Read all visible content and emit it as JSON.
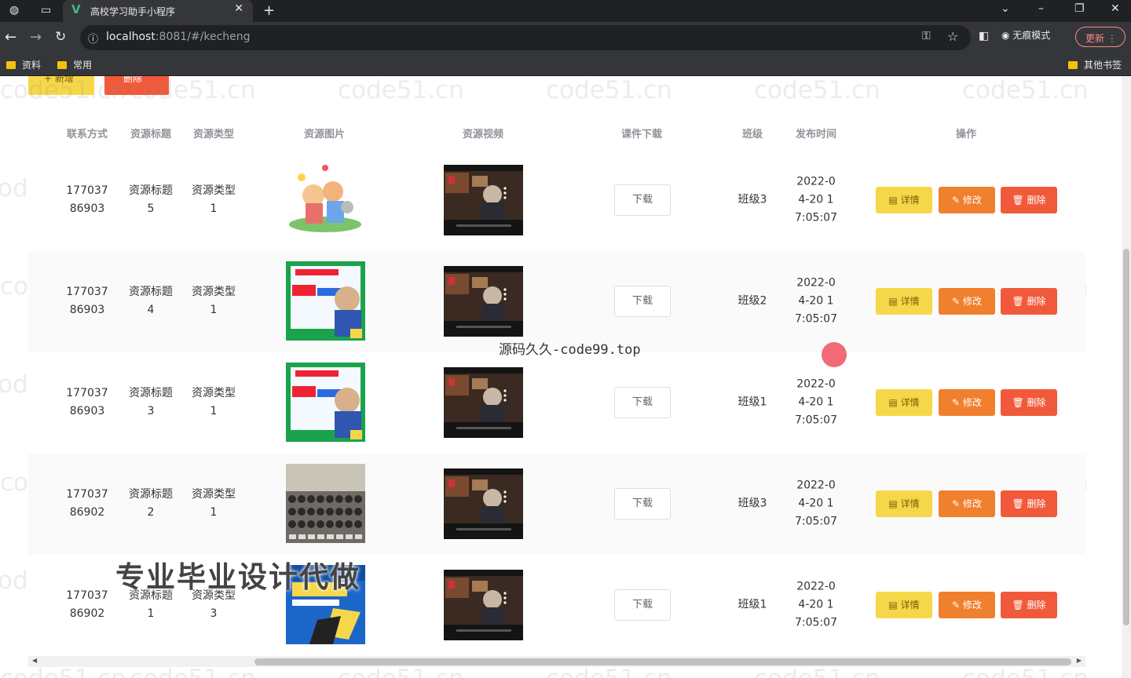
{
  "browser": {
    "tab_title": "高校学习助手小程序",
    "new_tab": "+",
    "url_host": "localhost",
    "url_rest": ":8081/#/kecheng",
    "incognito_label": "无痕模式",
    "update_label": "更新",
    "bookmarks": [
      "资料",
      "常用"
    ],
    "other_bookmarks": "其他书签"
  },
  "toolbar": {
    "add_label": "+ 新增",
    "delete_label": "删除"
  },
  "table": {
    "headers": [
      "联系方式",
      "资源标题",
      "资源类型",
      "资源图片",
      "资源视频",
      "课件下载",
      "班级",
      "发布时间",
      "操作"
    ],
    "download_label": "下载",
    "detail_label": "详情",
    "edit_label": "修改",
    "delete_label": "删除",
    "rows": [
      {
        "contact": "17703786903",
        "title": "资源标题5",
        "type": "资源类型1",
        "class": "班级3",
        "time": "2022-04-20 17:05:07",
        "image": "cartoon"
      },
      {
        "contact": "17703786903",
        "title": "资源标题4",
        "type": "资源类型1",
        "class": "班级2",
        "time": "2022-04-20 17:05:07",
        "image": "math"
      },
      {
        "contact": "17703786903",
        "title": "资源标题3",
        "type": "资源类型1",
        "class": "班级1",
        "time": "2022-04-20 17:05:07",
        "image": "math"
      },
      {
        "contact": "17703786902",
        "title": "资源标题2",
        "type": "资源类型1",
        "class": "班级3",
        "time": "2022-04-20 17:05:07",
        "image": "classroom"
      },
      {
        "contact": "17703786902",
        "title": "资源标题1",
        "type": "资源类型3",
        "class": "班级1",
        "time": "2022-04-20 17:05:07",
        "image": "book"
      }
    ]
  },
  "overlays": {
    "site_text": "源码久久-code99.top",
    "ad_text": "专业毕业设计代做",
    "watermark": "code51.cn"
  },
  "colors": {
    "detail": "#f7d74a",
    "edit": "#f0802e",
    "delete": "#f05a3a"
  }
}
